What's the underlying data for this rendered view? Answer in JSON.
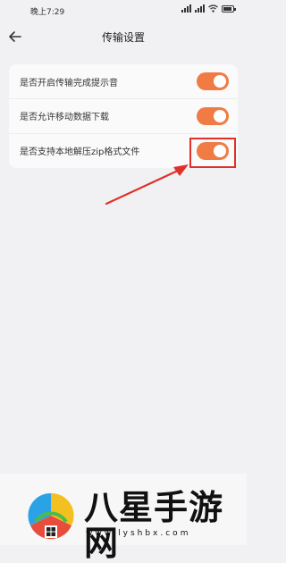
{
  "status_bar": {
    "time": "晚上7:29"
  },
  "header": {
    "title": "传输设置"
  },
  "settings": {
    "items": [
      {
        "label": "是否开启传输完成提示音",
        "enabled": true
      },
      {
        "label": "是否允许移动数据下载",
        "enabled": true
      },
      {
        "label": "是否支持本地解压zip格式文件",
        "enabled": true
      }
    ]
  },
  "colors": {
    "toggle_on": "#f07b45",
    "highlight": "#e0302a",
    "background": "#f1f1f3"
  },
  "watermark": {
    "text": "八星手游网",
    "url": "www.lyshbx.com"
  }
}
